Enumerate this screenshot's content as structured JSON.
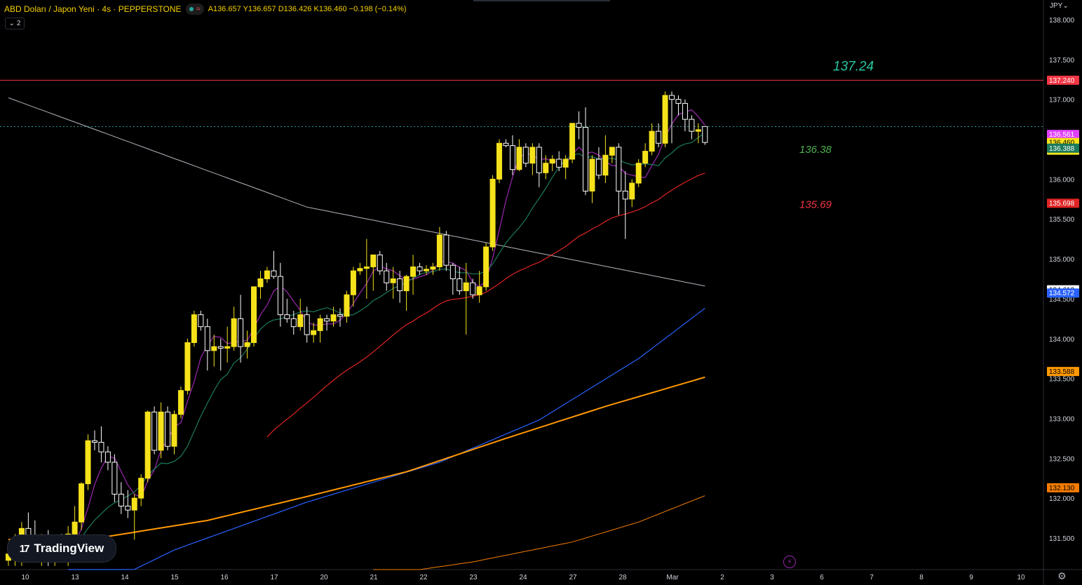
{
  "header": {
    "symbol_title": "ABD Doları / Japon Yeni · 4s · PEPPERSTONE",
    "ohlc_text": "A136.657 Y136.657 D136.426 K136.460 −0.198 (−0.14%)",
    "indicators_count": "2"
  },
  "currency_label": "JPY",
  "brand": "TradingView",
  "colors": {
    "background": "#000000",
    "up_candle": "#f6e21a",
    "down_candle": "#ffffff",
    "resistance_line": "#f23645",
    "text": "#d1d4dc"
  },
  "chart_data": {
    "type": "candlestick",
    "x_axis_labels": [
      "10",
      "13",
      "14",
      "15",
      "16",
      "17",
      "20",
      "21",
      "22",
      "23",
      "24",
      "27",
      "28",
      "Mar",
      "2",
      "3",
      "6",
      "7",
      "8",
      "9",
      "10"
    ],
    "y_axis_ticks": [
      "138.000",
      "137.500",
      "137.000",
      "136.500",
      "136.000",
      "135.500",
      "135.000",
      "134.500",
      "134.000",
      "133.500",
      "133.000",
      "132.500",
      "132.000",
      "131.500"
    ],
    "ylim": [
      131.15,
      138.15
    ],
    "candles": [
      {
        "o": 131.22,
        "h": 131.35,
        "l": 131.15,
        "c": 131.3
      },
      {
        "o": 131.3,
        "h": 131.55,
        "l": 131.15,
        "c": 131.48
      },
      {
        "o": 131.48,
        "h": 131.7,
        "l": 131.15,
        "c": 131.62
      },
      {
        "o": 131.62,
        "h": 131.82,
        "l": 131.4,
        "c": 131.5
      },
      {
        "o": 131.5,
        "h": 131.72,
        "l": 131.25,
        "c": 131.35
      },
      {
        "o": 131.35,
        "h": 131.55,
        "l": 131.15,
        "c": 131.42
      },
      {
        "o": 131.42,
        "h": 131.6,
        "l": 131.15,
        "c": 131.3
      },
      {
        "o": 131.3,
        "h": 131.52,
        "l": 131.15,
        "c": 131.4
      },
      {
        "o": 131.4,
        "h": 131.55,
        "l": 131.2,
        "c": 131.25
      },
      {
        "o": 131.25,
        "h": 131.65,
        "l": 131.15,
        "c": 131.55
      },
      {
        "o": 131.55,
        "h": 131.9,
        "l": 131.4,
        "c": 131.7
      },
      {
        "o": 131.7,
        "h": 132.2,
        "l": 131.6,
        "c": 132.18
      },
      {
        "o": 132.18,
        "h": 132.8,
        "l": 132.1,
        "c": 132.72
      },
      {
        "o": 132.72,
        "h": 132.85,
        "l": 132.6,
        "c": 132.7
      },
      {
        "o": 132.7,
        "h": 132.9,
        "l": 132.45,
        "c": 132.58
      },
      {
        "o": 132.58,
        "h": 132.65,
        "l": 132.35,
        "c": 132.45
      },
      {
        "o": 132.45,
        "h": 132.55,
        "l": 131.95,
        "c": 132.05
      },
      {
        "o": 132.05,
        "h": 132.2,
        "l": 131.8,
        "c": 131.9
      },
      {
        "o": 131.9,
        "h": 132.1,
        "l": 131.75,
        "c": 131.85
      },
      {
        "o": 131.85,
        "h": 132.05,
        "l": 131.48,
        "c": 132.0
      },
      {
        "o": 132.0,
        "h": 132.3,
        "l": 131.9,
        "c": 132.25
      },
      {
        "o": 132.25,
        "h": 133.1,
        "l": 132.2,
        "c": 133.08
      },
      {
        "o": 133.08,
        "h": 133.15,
        "l": 132.55,
        "c": 132.6
      },
      {
        "o": 132.6,
        "h": 133.2,
        "l": 132.5,
        "c": 133.08
      },
      {
        "o": 133.08,
        "h": 133.15,
        "l": 132.6,
        "c": 132.65
      },
      {
        "o": 132.65,
        "h": 133.1,
        "l": 132.55,
        "c": 133.05
      },
      {
        "o": 133.05,
        "h": 133.4,
        "l": 133.0,
        "c": 133.35
      },
      {
        "o": 133.35,
        "h": 134.0,
        "l": 133.3,
        "c": 133.95
      },
      {
        "o": 133.95,
        "h": 134.35,
        "l": 133.9,
        "c": 134.3
      },
      {
        "o": 134.3,
        "h": 134.35,
        "l": 134.1,
        "c": 134.15
      },
      {
        "o": 134.15,
        "h": 134.25,
        "l": 133.6,
        "c": 133.85
      },
      {
        "o": 133.85,
        "h": 134.05,
        "l": 133.65,
        "c": 133.9
      },
      {
        "o": 133.9,
        "h": 134.0,
        "l": 133.6,
        "c": 133.88
      },
      {
        "o": 133.88,
        "h": 134.15,
        "l": 133.7,
        "c": 133.9
      },
      {
        "o": 133.9,
        "h": 134.4,
        "l": 133.85,
        "c": 134.25
      },
      {
        "o": 134.25,
        "h": 134.55,
        "l": 133.7,
        "c": 133.9
      },
      {
        "o": 133.9,
        "h": 134.1,
        "l": 133.75,
        "c": 133.95
      },
      {
        "o": 133.95,
        "h": 134.65,
        "l": 133.9,
        "c": 134.65
      },
      {
        "o": 134.65,
        "h": 134.85,
        "l": 134.5,
        "c": 134.75
      },
      {
        "o": 134.75,
        "h": 134.9,
        "l": 134.7,
        "c": 134.85
      },
      {
        "o": 134.85,
        "h": 135.1,
        "l": 134.75,
        "c": 134.78
      },
      {
        "o": 134.78,
        "h": 134.95,
        "l": 134.15,
        "c": 134.3
      },
      {
        "o": 134.3,
        "h": 134.5,
        "l": 134.2,
        "c": 134.25
      },
      {
        "o": 134.25,
        "h": 134.35,
        "l": 134.05,
        "c": 134.15
      },
      {
        "o": 134.15,
        "h": 134.5,
        "l": 134.1,
        "c": 134.3
      },
      {
        "o": 134.3,
        "h": 134.4,
        "l": 133.95,
        "c": 134.05
      },
      {
        "o": 134.05,
        "h": 134.2,
        "l": 133.95,
        "c": 134.1
      },
      {
        "o": 134.1,
        "h": 134.3,
        "l": 133.95,
        "c": 134.25
      },
      {
        "o": 134.25,
        "h": 134.3,
        "l": 134.1,
        "c": 134.22
      },
      {
        "o": 134.22,
        "h": 134.4,
        "l": 134.15,
        "c": 134.3
      },
      {
        "o": 134.3,
        "h": 134.38,
        "l": 134.15,
        "c": 134.28
      },
      {
        "o": 134.28,
        "h": 134.6,
        "l": 134.2,
        "c": 134.55
      },
      {
        "o": 134.55,
        "h": 134.9,
        "l": 134.4,
        "c": 134.85
      },
      {
        "o": 134.85,
        "h": 134.95,
        "l": 134.8,
        "c": 134.88
      },
      {
        "o": 134.88,
        "h": 135.25,
        "l": 134.5,
        "c": 134.9
      },
      {
        "o": 134.9,
        "h": 135.05,
        "l": 134.6,
        "c": 135.05
      },
      {
        "o": 135.05,
        "h": 135.1,
        "l": 134.8,
        "c": 134.85
      },
      {
        "o": 134.85,
        "h": 134.95,
        "l": 134.6,
        "c": 134.7
      },
      {
        "o": 134.7,
        "h": 134.9,
        "l": 134.5,
        "c": 134.75
      },
      {
        "o": 134.75,
        "h": 134.85,
        "l": 134.45,
        "c": 134.6
      },
      {
        "o": 134.6,
        "h": 134.8,
        "l": 134.35,
        "c": 134.78
      },
      {
        "o": 134.78,
        "h": 135.05,
        "l": 134.55,
        "c": 134.9
      },
      {
        "o": 134.9,
        "h": 134.95,
        "l": 134.8,
        "c": 134.85
      },
      {
        "o": 134.85,
        "h": 134.92,
        "l": 134.8,
        "c": 134.87
      },
      {
        "o": 134.87,
        "h": 134.95,
        "l": 134.8,
        "c": 134.9
      },
      {
        "o": 134.9,
        "h": 135.4,
        "l": 134.85,
        "c": 135.3
      },
      {
        "o": 135.3,
        "h": 135.35,
        "l": 134.85,
        "c": 134.92
      },
      {
        "o": 134.92,
        "h": 134.95,
        "l": 134.55,
        "c": 134.75
      },
      {
        "o": 134.75,
        "h": 134.9,
        "l": 134.55,
        "c": 134.6
      },
      {
        "o": 134.6,
        "h": 134.95,
        "l": 134.05,
        "c": 134.7
      },
      {
        "o": 134.7,
        "h": 134.75,
        "l": 134.5,
        "c": 134.55
      },
      {
        "o": 134.55,
        "h": 134.85,
        "l": 134.45,
        "c": 134.65
      },
      {
        "o": 134.65,
        "h": 135.2,
        "l": 134.6,
        "c": 135.15
      },
      {
        "o": 135.15,
        "h": 136.05,
        "l": 135.1,
        "c": 136.0
      },
      {
        "o": 136.0,
        "h": 136.5,
        "l": 135.95,
        "c": 136.45
      },
      {
        "o": 136.45,
        "h": 136.5,
        "l": 136.4,
        "c": 136.42
      },
      {
        "o": 136.42,
        "h": 136.55,
        "l": 136.05,
        "c": 136.12
      },
      {
        "o": 136.12,
        "h": 136.5,
        "l": 136.1,
        "c": 136.4
      },
      {
        "o": 136.4,
        "h": 136.45,
        "l": 136.15,
        "c": 136.2
      },
      {
        "o": 136.2,
        "h": 136.45,
        "l": 136.05,
        "c": 136.4
      },
      {
        "o": 136.4,
        "h": 136.45,
        "l": 135.9,
        "c": 136.08
      },
      {
        "o": 136.08,
        "h": 136.3,
        "l": 136.0,
        "c": 136.2
      },
      {
        "o": 136.2,
        "h": 136.3,
        "l": 136.1,
        "c": 136.25
      },
      {
        "o": 136.25,
        "h": 136.35,
        "l": 136.1,
        "c": 136.15
      },
      {
        "o": 136.15,
        "h": 136.3,
        "l": 136.0,
        "c": 136.25
      },
      {
        "o": 136.25,
        "h": 136.7,
        "l": 136.2,
        "c": 136.7
      },
      {
        "o": 136.7,
        "h": 136.85,
        "l": 136.5,
        "c": 136.65
      },
      {
        "o": 136.65,
        "h": 136.9,
        "l": 135.8,
        "c": 135.85
      },
      {
        "o": 135.85,
        "h": 136.3,
        "l": 135.7,
        "c": 136.25
      },
      {
        "o": 136.25,
        "h": 136.4,
        "l": 136.0,
        "c": 136.05
      },
      {
        "o": 136.05,
        "h": 136.55,
        "l": 135.95,
        "c": 136.3
      },
      {
        "o": 136.3,
        "h": 136.4,
        "l": 136.2,
        "c": 136.4
      },
      {
        "o": 136.4,
        "h": 136.45,
        "l": 135.55,
        "c": 135.85
      },
      {
        "o": 135.85,
        "h": 136.1,
        "l": 135.25,
        "c": 135.75
      },
      {
        "o": 135.75,
        "h": 136.0,
        "l": 135.65,
        "c": 135.95
      },
      {
        "o": 135.95,
        "h": 136.25,
        "l": 135.9,
        "c": 136.2
      },
      {
        "o": 136.2,
        "h": 136.45,
        "l": 136.15,
        "c": 136.35
      },
      {
        "o": 136.35,
        "h": 136.7,
        "l": 136.3,
        "c": 136.6
      },
      {
        "o": 136.6,
        "h": 136.7,
        "l": 136.4,
        "c": 136.45
      },
      {
        "o": 136.45,
        "h": 137.1,
        "l": 136.4,
        "c": 137.05
      },
      {
        "o": 137.05,
        "h": 137.1,
        "l": 136.45,
        "c": 137.0
      },
      {
        "o": 137.0,
        "h": 137.05,
        "l": 136.8,
        "c": 136.95
      },
      {
        "o": 136.95,
        "h": 137.0,
        "l": 136.6,
        "c": 136.75
      },
      {
        "o": 136.75,
        "h": 136.8,
        "l": 136.5,
        "c": 136.6
      },
      {
        "o": 136.6,
        "h": 136.7,
        "l": 136.45,
        "c": 136.62
      },
      {
        "o": 136.66,
        "h": 136.66,
        "l": 136.43,
        "c": 136.46
      }
    ],
    "horizontal_line": {
      "price": 137.24,
      "label": "137.24",
      "color": "#f23645",
      "label_color": "#26c6a0"
    },
    "annotations": [
      {
        "text": "136.38",
        "color": "#4caf50"
      },
      {
        "text": "135.69",
        "color": "#f23645"
      }
    ],
    "moving_averages": [
      {
        "color": "#9c27b0",
        "width": 1.2,
        "period": 5
      },
      {
        "color": "#1b7a5a",
        "width": 1.2,
        "period": 12
      },
      {
        "color": "#e02424",
        "width": 1.2,
        "period": 40
      },
      {
        "color": "#2962ff",
        "width": 1.2,
        "points": [
          [
            9,
            130.7
          ],
          [
            25,
            131.35
          ],
          [
            45,
            131.95
          ],
          [
            65,
            132.45
          ],
          [
            80,
            132.98
          ],
          [
            95,
            133.75
          ],
          [
            108,
            134.57
          ]
        ]
      },
      {
        "color": "#ff9800",
        "width": 2.0,
        "points": [
          [
            0,
            131.48
          ],
          [
            15,
            131.52
          ],
          [
            30,
            131.72
          ],
          [
            45,
            132.02
          ],
          [
            60,
            132.33
          ],
          [
            75,
            132.75
          ],
          [
            90,
            133.15
          ],
          [
            108,
            133.59
          ]
        ]
      },
      {
        "color": "#f57c00",
        "width": 1.0,
        "points": [
          [
            55,
            131.02
          ],
          [
            70,
            131.2
          ],
          [
            85,
            131.45
          ],
          [
            95,
            131.7
          ],
          [
            108,
            132.13
          ]
        ]
      }
    ],
    "trendline": {
      "color": "#b2b5be",
      "points": [
        [
          0,
          137.02
        ],
        [
          45,
          135.65
        ],
        [
          108,
          134.61
        ]
      ]
    },
    "price_labels": [
      {
        "text": "137.240",
        "price": 137.24,
        "bg": "#f23645",
        "fg": "#ffffff"
      },
      {
        "text": "136.561",
        "price": 136.561,
        "bg": "#e040fb",
        "fg": "#ffffff"
      },
      {
        "text": "136.460",
        "sub": "03:28:30",
        "price": 136.46,
        "bg": "#f6e21a",
        "fg": "#000000"
      },
      {
        "text": "136.388",
        "price": 136.388,
        "bg": "#1b7a5a",
        "fg": "#ffffff"
      },
      {
        "text": "135.698",
        "price": 135.698,
        "bg": "#e02424",
        "fg": "#ffffff"
      },
      {
        "text": "134.613",
        "price": 134.613,
        "bg": "#ffffff",
        "fg": "#000000"
      },
      {
        "text": "134.572",
        "price": 134.572,
        "bg": "#2962ff",
        "fg": "#ffffff"
      },
      {
        "text": "133.588",
        "price": 133.588,
        "bg": "#ff9800",
        "fg": "#000000"
      },
      {
        "text": "132.130",
        "price": 132.13,
        "bg": "#f57c00",
        "fg": "#000000"
      }
    ],
    "current_price_dotted": 136.66
  }
}
